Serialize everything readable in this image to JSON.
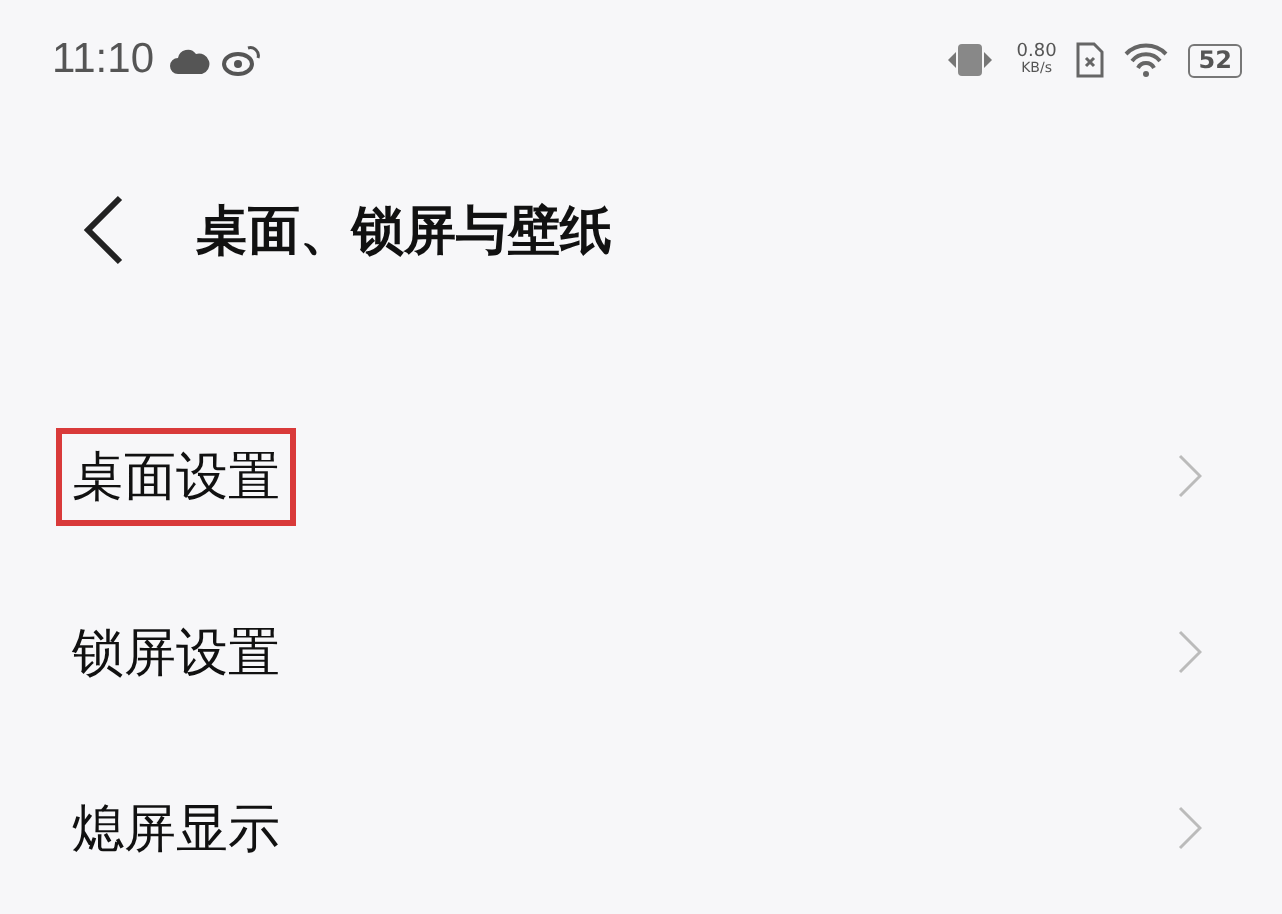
{
  "status_bar": {
    "time": "11:10",
    "speed": "0.80",
    "speed_unit": "KB/s",
    "battery": "52"
  },
  "header": {
    "title": "桌面、锁屏与壁纸"
  },
  "items": [
    {
      "label": "桌面设置",
      "highlighted": true
    },
    {
      "label": "锁屏设置",
      "highlighted": false
    },
    {
      "label": "熄屏显示",
      "highlighted": false
    }
  ]
}
